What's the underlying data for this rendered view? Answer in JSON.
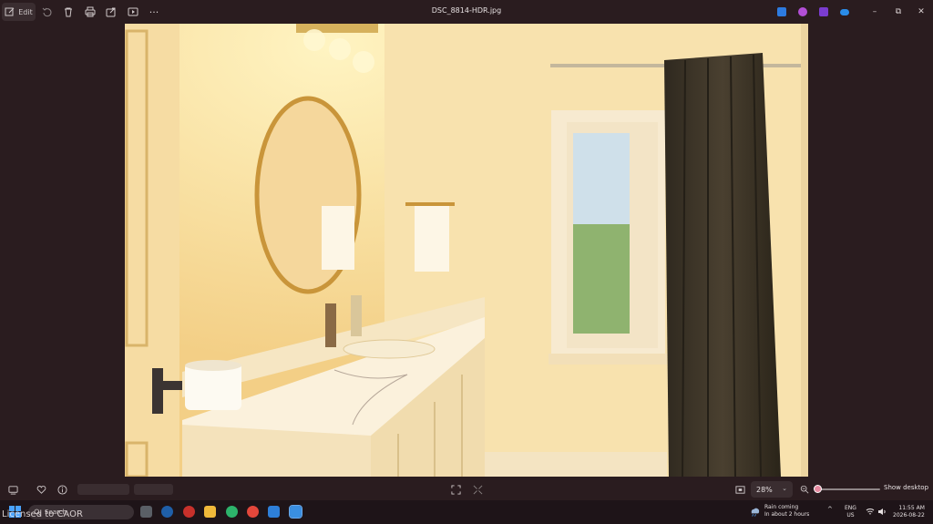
{
  "window": {
    "title": "DSC_8814-HDR.jpg"
  },
  "toolbar": {
    "edit_label": "Edit",
    "icons": [
      "edit-icon",
      "rotate-icon",
      "delete-icon",
      "print-icon",
      "share-icon",
      "slideshow-icon",
      "more-icon"
    ],
    "more_label": "···"
  },
  "app_icons": [
    "clipchamp-icon",
    "designer-icon",
    "onenote-icon",
    "onedrive-icon"
  ],
  "window_controls": {
    "minimize": "–",
    "maximize": "⧉",
    "close": "✕"
  },
  "photo": {
    "subject": "bathroom",
    "colors": {
      "wall": "#f5d896",
      "curtain": "#3a3226",
      "counter": "#fbf1dc",
      "mirror_frame": "#c9953a"
    }
  },
  "bottombar": {
    "zoom_value": "28%",
    "zoom_fraction": 0.02,
    "show_desktop_label": "Show desktop"
  },
  "taskbar": {
    "search_placeholder": "Search",
    "weather_line1": "Rain coming",
    "weather_line2": "In about 2 hours",
    "tray_chevron": "^",
    "lang_line1": "ENG",
    "lang_line2": "US",
    "time": "11:55 AM",
    "date": "2026-08-22"
  },
  "watermark": "Licensed to CAOR"
}
